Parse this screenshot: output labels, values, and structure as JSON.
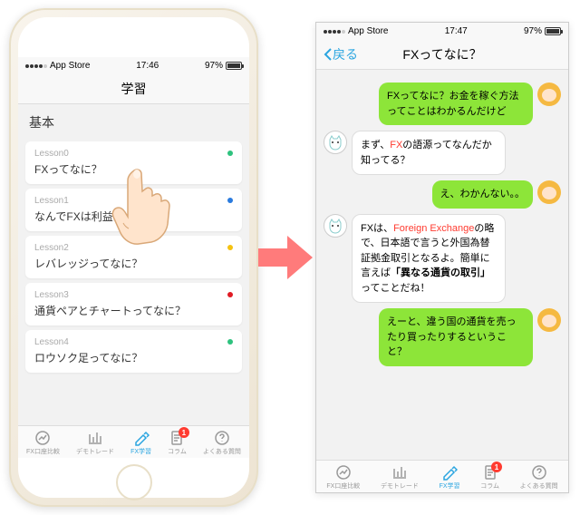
{
  "phone1": {
    "status": {
      "carrier": "App Store",
      "time": "17:46",
      "battery": "97%"
    },
    "navTitle": "学習",
    "sectionTitle": "基本",
    "lessons": [
      {
        "label": "Lesson0",
        "title": "FXってなに？",
        "dot": "#2ec27e"
      },
      {
        "label": "Lesson1",
        "title": "なんでFXは利益が",
        "dot": "#2a7bde"
      },
      {
        "label": "Lesson2",
        "title": "レバレッジってなに？",
        "dot": "#f5c211"
      },
      {
        "label": "Lesson3",
        "title": "通貨ペアとチャートってなに？",
        "dot": "#e01b24"
      },
      {
        "label": "Lesson4",
        "title": "ロウソク足ってなに？",
        "dot": "#2ec27e"
      }
    ]
  },
  "phone2": {
    "status": {
      "carrier": "App Store",
      "time": "17:47",
      "battery": "97%"
    },
    "backLabel": "戻る",
    "navTitle": "FXってなに？",
    "messages": [
      {
        "side": "r",
        "avatar": "girl",
        "style": "g",
        "text": "FXってなに？お金を稼ぐ方法ってことはわかるんだけど"
      },
      {
        "side": "l",
        "avatar": "cat",
        "style": "w",
        "html": "まず、<span class='hi'>FX</span>の語源ってなんだか知ってる？"
      },
      {
        "side": "r",
        "avatar": "girl",
        "style": "g",
        "text": "え、わかんない。。"
      },
      {
        "side": "l",
        "avatar": "cat",
        "style": "w",
        "html": "FXは、<span class='hi'>Foreign Exchange</span>の略で、日本語で言うと外国為替証拠金取引となるよ。簡単に言えば<span class='bold'>「異なる通貨の取引」</span>ってことだね！"
      },
      {
        "side": "r",
        "avatar": "girl",
        "style": "g",
        "text": "えーと、違う国の通貨を売ったり買ったりするということ？"
      }
    ]
  },
  "tabs": [
    {
      "name": "fx-compare",
      "label": "FX口座比較",
      "icon": "chart"
    },
    {
      "name": "demo",
      "label": "デモトレード",
      "icon": "graph"
    },
    {
      "name": "learn",
      "label": "FX学習",
      "icon": "pen",
      "active": true
    },
    {
      "name": "column",
      "label": "コラム",
      "icon": "doc",
      "badge": "1"
    },
    {
      "name": "faq",
      "label": "よくある質問",
      "icon": "help"
    }
  ],
  "colors": {
    "accent": "#2aa5e0",
    "arrow": "#ff6b6b"
  }
}
